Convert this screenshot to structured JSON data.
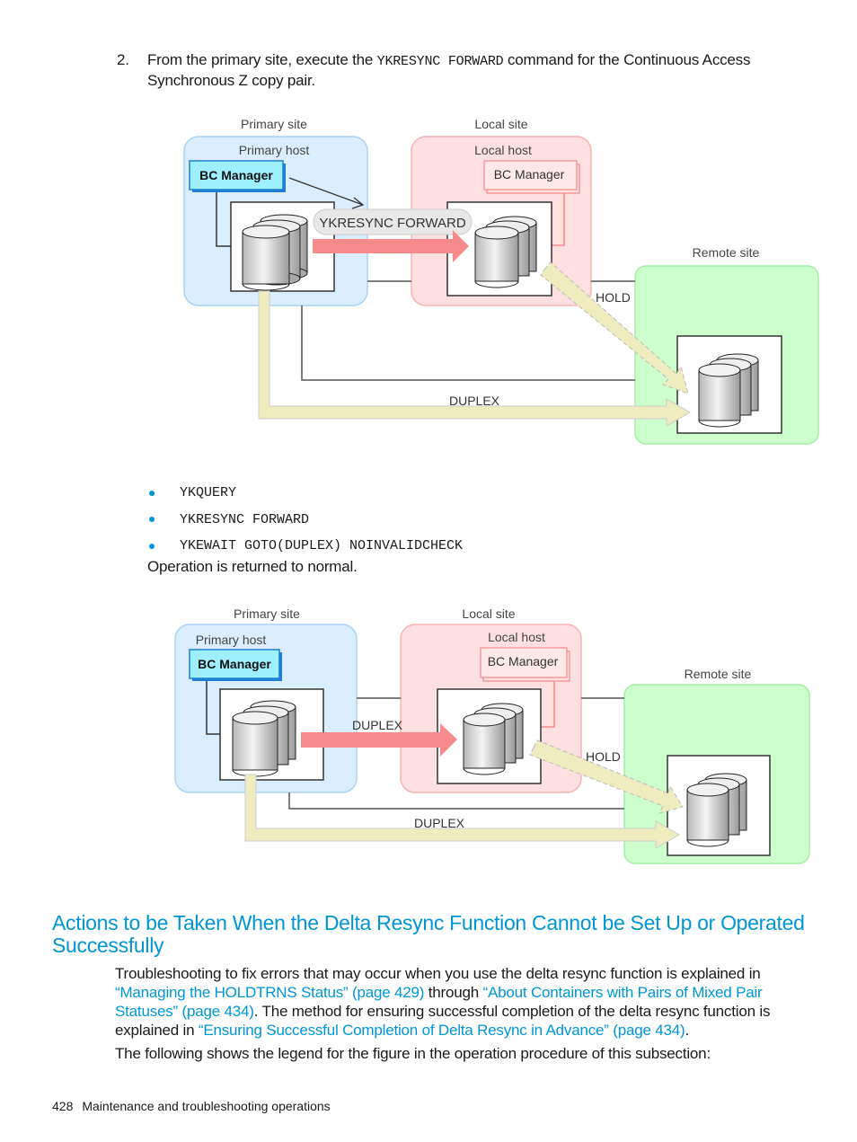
{
  "step": {
    "number": "2.",
    "text_before": "From the primary site, execute the ",
    "command": "YKRESYNC FORWARD",
    "text_after": " command for the Continuous Access Synchronous Z copy pair."
  },
  "diagram1": {
    "primary_site_label": "Primary site",
    "primary_host_label": "Primary host",
    "bc_manager_primary": "BC Manager",
    "local_site_label": "Local site",
    "local_host_label": "Local host",
    "bc_manager_local": "BC Manager",
    "remote_site_label": "Remote site",
    "command_bubble": "YKRESYNC FORWARD",
    "hold_label": "HOLD",
    "duplex_label": "DUPLEX"
  },
  "commands": [
    "YKQUERY",
    "YKRESYNC FORWARD",
    "YKEWAIT GOTO(DUPLEX) NOINVALIDCHECK"
  ],
  "operation_normal": "Operation is returned to normal.",
  "diagram2": {
    "primary_site_label": "Primary site",
    "primary_host_label": "Primary host",
    "bc_manager_primary": "BC Manager",
    "local_site_label": "Local site",
    "local_host_label": "Local host",
    "bc_manager_local": "BC Manager",
    "remote_site_label": "Remote site",
    "duplex_top_label": "DUPLEX",
    "hold_label": "HOLD",
    "duplex_label": "DUPLEX"
  },
  "section": {
    "heading": "Actions to be Taken When the Delta Resync Function Cannot be Set Up or Operated Successfully",
    "para1_part1": "Troubleshooting to fix errors that may occur when you use the delta resync function is explained in ",
    "link1": "“Managing the HOLDTRNS Status” (page 429)",
    "para1_part2": " through ",
    "link2": "“About Containers with Pairs of Mixed Pair Statuses” (page 434)",
    "para1_part3": ". The method for ensuring successful completion of the delta resync function is explained in ",
    "link3": "“Ensuring Successful Completion of Delta Resync in Advance” (page 434)",
    "para1_part4": ".",
    "para2": "The following shows the legend for the figure in the operation procedure of this subsection:"
  },
  "footer": {
    "page_number": "428",
    "title": "Maintenance and troubleshooting operations"
  },
  "colors": {
    "accent": "#0096d6",
    "primary_site_fill": "#dbeeff",
    "local_site_fill": "#ffe0e0",
    "remote_site_fill": "#ccffcc",
    "copy_arrow": "#f78b8b",
    "pair_arrow": "#efedbf"
  }
}
